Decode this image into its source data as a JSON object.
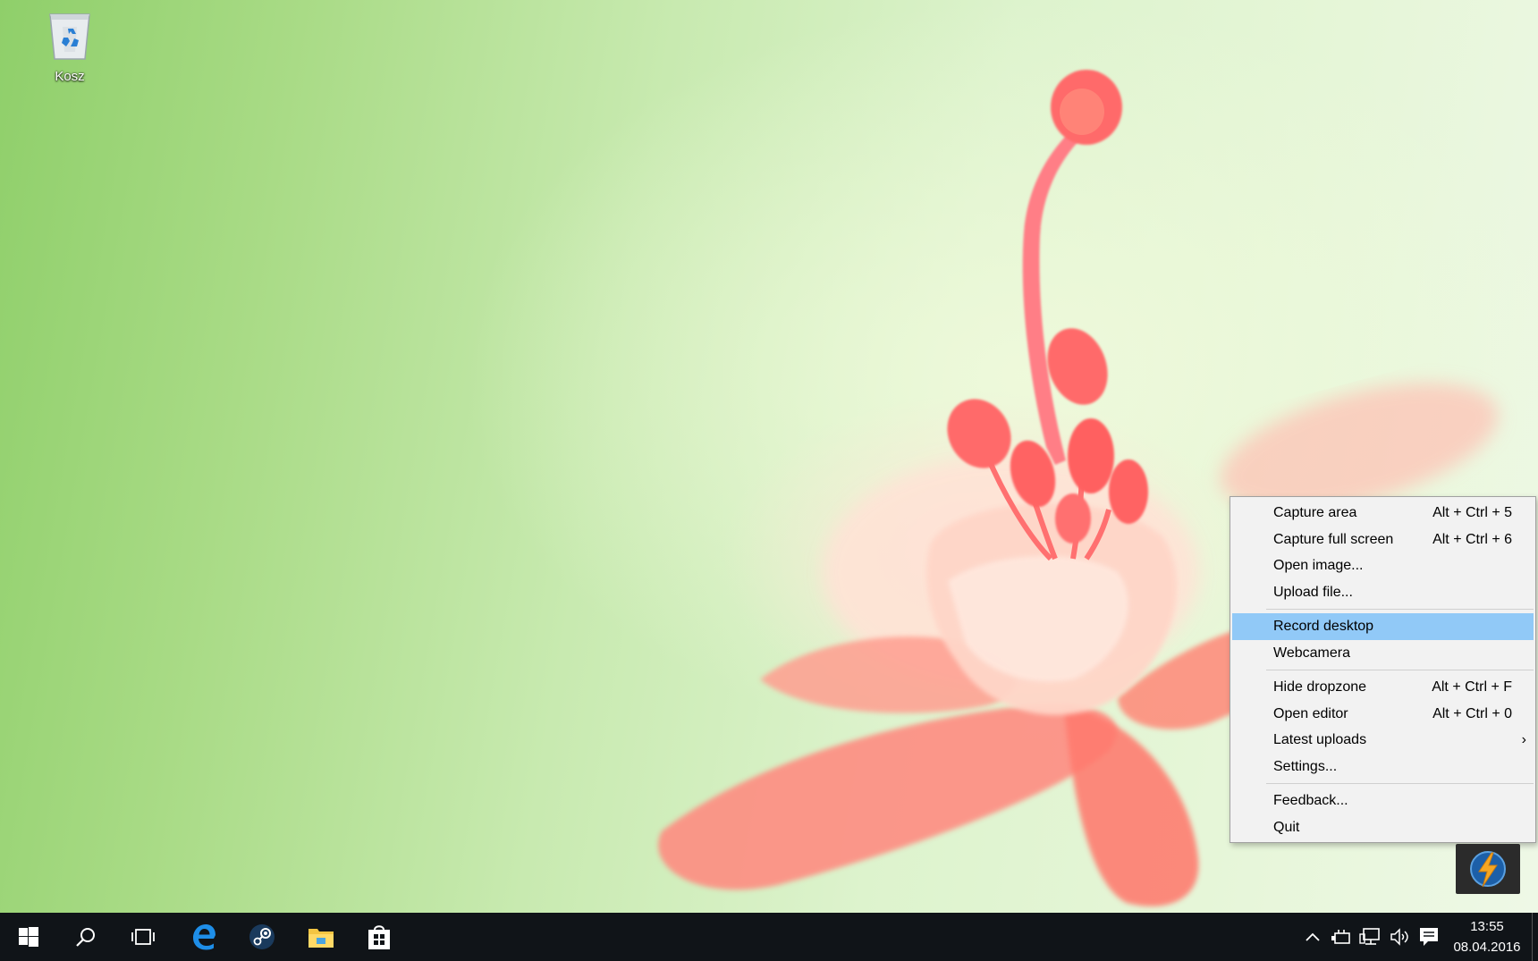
{
  "desktop": {
    "recycle_bin_label": "Kosz"
  },
  "context_menu": {
    "items": [
      {
        "label": "Capture area",
        "shortcut": "Alt + Ctrl + 5"
      },
      {
        "label": "Capture full screen",
        "shortcut": "Alt + Ctrl + 6"
      },
      {
        "label": "Open image...",
        "shortcut": ""
      },
      {
        "label": "Upload file...",
        "shortcut": ""
      },
      {
        "label": "Record desktop",
        "shortcut": "",
        "highlighted": true
      },
      {
        "label": "Webcamera",
        "shortcut": ""
      },
      {
        "label": "Hide dropzone",
        "shortcut": "Alt + Ctrl + F"
      },
      {
        "label": "Open editor",
        "shortcut": "Alt + Ctrl + 0"
      },
      {
        "label": "Latest uploads",
        "shortcut": "",
        "submenu_arrow": "›"
      },
      {
        "label": "Settings...",
        "shortcut": ""
      },
      {
        "label": "Feedback...",
        "shortcut": ""
      },
      {
        "label": "Quit",
        "shortcut": ""
      }
    ],
    "highlight_color": "#91c9f7"
  },
  "taskbar": {
    "pinned": [
      {
        "name": "start-icon"
      },
      {
        "name": "search-icon"
      },
      {
        "name": "task-view-icon"
      },
      {
        "name": "edge-icon"
      },
      {
        "name": "steam-icon"
      },
      {
        "name": "file-explorer-icon"
      },
      {
        "name": "store-icon"
      }
    ],
    "tray_icons": [
      "chevron-up-icon",
      "power-icon",
      "network-icon",
      "volume-icon",
      "action-center-icon"
    ],
    "clock": {
      "time": "13:55",
      "date": "08.04.2016"
    },
    "background_color": "#101418"
  }
}
